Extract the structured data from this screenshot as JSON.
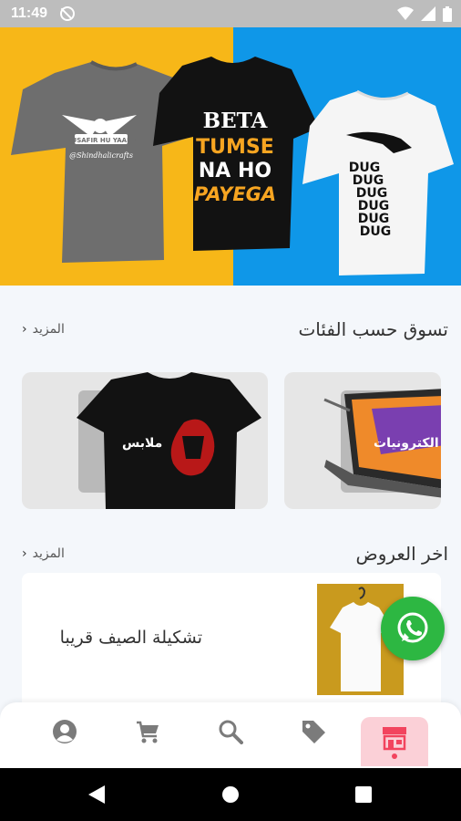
{
  "status_bar": {
    "time": "11:49"
  },
  "hero": {
    "shirts": [
      {
        "name": "gray-biker-shirt",
        "text_lines": [
          "MUSAFIR HU YAARO"
        ],
        "script_text": "@Shindhalicrafts"
      },
      {
        "name": "black-text-shirt",
        "text_lines": [
          "BETA",
          "TUMSE",
          "NA HO",
          "PAYEGA"
        ]
      },
      {
        "name": "white-dug-shirt",
        "text_lines": [
          "DUG",
          "DUG",
          "DUG",
          "DUG",
          "DUG",
          "DUG"
        ]
      }
    ]
  },
  "categories_section": {
    "title": "تسوق حسب الفئات",
    "more_label": "المزيد",
    "items": [
      {
        "label": "ملابس"
      },
      {
        "label": "الكترونيات"
      }
    ]
  },
  "offers_section": {
    "title": "اخر العروض",
    "more_label": "المزيد",
    "offer_text": "تشكيلة الصيف قريبا"
  },
  "bottom_tabs": [
    {
      "icon": "user-icon"
    },
    {
      "icon": "cart-icon"
    },
    {
      "icon": "search-icon"
    },
    {
      "icon": "tag-icon"
    },
    {
      "icon": "store-icon",
      "active": true
    }
  ],
  "colors": {
    "hero_left": "#f7b718",
    "hero_right": "#0f97e8",
    "accent": "#f2445e",
    "whatsapp": "#2db742"
  }
}
